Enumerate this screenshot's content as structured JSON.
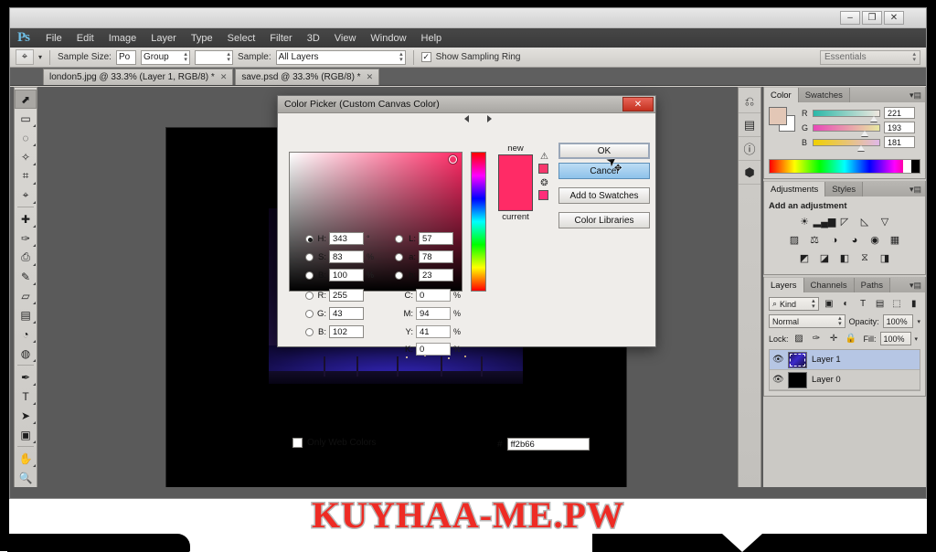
{
  "window": {
    "minimize": "–",
    "maximize": "❐",
    "close": "✕"
  },
  "menubar": {
    "logo": "Ps",
    "items": [
      "File",
      "Edit",
      "Image",
      "Layer",
      "Type",
      "Select",
      "Filter",
      "3D",
      "View",
      "Window",
      "Help"
    ]
  },
  "options_bar": {
    "tool_icon": "eyedropper-icon",
    "sample_size_label": "Sample Size:",
    "sample_size_value": "Po",
    "group_value": "Group",
    "blank_value": "",
    "sample_label": "Sample:",
    "sample_value": "All Layers",
    "show_sampling_ring_label": "Show Sampling Ring",
    "show_sampling_ring_checked": "✓",
    "workspace": "Essentials"
  },
  "tabs": [
    {
      "label": "london5.jpg @ 33.3% (Layer 1, RGB/8) *",
      "close": "✕"
    },
    {
      "label": "save.psd @ 33.3% (RGB/8) *",
      "close": "✕"
    }
  ],
  "toolbar": {
    "tools": [
      {
        "name": "move-tool",
        "glyph": "⬈",
        "selected": true
      },
      {
        "name": "marquee-tool",
        "glyph": "▭"
      },
      {
        "name": "lasso-tool",
        "glyph": "◌"
      },
      {
        "name": "quick-selection-tool",
        "glyph": "✧"
      },
      {
        "name": "crop-tool",
        "glyph": "⌗"
      },
      {
        "name": "eyedropper-tool",
        "glyph": "⌖"
      },
      {
        "name": "spot-healing-tool",
        "glyph": "✚"
      },
      {
        "name": "brush-tool",
        "glyph": "✑"
      },
      {
        "name": "clone-stamp-tool",
        "glyph": "⎙"
      },
      {
        "name": "history-brush-tool",
        "glyph": "✎"
      },
      {
        "name": "eraser-tool",
        "glyph": "▱"
      },
      {
        "name": "gradient-tool",
        "glyph": "▤"
      },
      {
        "name": "blur-tool",
        "glyph": "◔"
      },
      {
        "name": "dodge-tool",
        "glyph": "◍"
      },
      {
        "name": "pen-tool",
        "glyph": "✒"
      },
      {
        "name": "type-tool",
        "glyph": "T"
      },
      {
        "name": "path-selection-tool",
        "glyph": "➤"
      },
      {
        "name": "rectangle-tool",
        "glyph": "▣"
      },
      {
        "name": "hand-tool",
        "glyph": "✋"
      },
      {
        "name": "zoom-tool",
        "glyph": "🔍"
      }
    ],
    "foreground_color": "#e3c7b6",
    "background_color": "#ffffff"
  },
  "dock_rail": {
    "icons": [
      {
        "name": "history-icon",
        "glyph": "⎌"
      },
      {
        "name": "properties-icon",
        "glyph": "▤"
      },
      {
        "name": "info-icon",
        "glyph": "ⓘ"
      },
      {
        "name": "3d-icon",
        "glyph": "⬢"
      }
    ]
  },
  "color_panel": {
    "tabs": [
      "Color",
      "Swatches"
    ],
    "active_tab": "Color",
    "menu_glyph": "▾▤",
    "foreground_color": "#e3c7b6",
    "background_color": "#ffffff",
    "channels": [
      {
        "label": "R",
        "value": "221"
      },
      {
        "label": "G",
        "value": "193"
      },
      {
        "label": "B",
        "value": "181"
      }
    ]
  },
  "adjustments_panel": {
    "tabs": [
      "Adjustments",
      "Styles"
    ],
    "active_tab": "Adjustments",
    "menu_glyph": "▾▤",
    "title": "Add an adjustment",
    "rows": [
      [
        {
          "name": "brightness-contrast-icon",
          "glyph": "☀"
        },
        {
          "name": "levels-icon",
          "glyph": "▂▄▆"
        },
        {
          "name": "curves-icon",
          "glyph": "◸"
        },
        {
          "name": "exposure-icon",
          "glyph": "◺"
        },
        {
          "name": "vibrance-icon",
          "glyph": "▽"
        }
      ],
      [
        {
          "name": "hue-saturation-icon",
          "glyph": "▨"
        },
        {
          "name": "color-balance-icon",
          "glyph": "⚖"
        },
        {
          "name": "black-white-icon",
          "glyph": "◑"
        },
        {
          "name": "photo-filter-icon",
          "glyph": "◕"
        },
        {
          "name": "channel-mixer-icon",
          "glyph": "◉"
        },
        {
          "name": "color-lookup-icon",
          "glyph": "▦"
        }
      ],
      [
        {
          "name": "invert-icon",
          "glyph": "◩"
        },
        {
          "name": "posterize-icon",
          "glyph": "◪"
        },
        {
          "name": "threshold-icon",
          "glyph": "◧"
        },
        {
          "name": "gradient-map-icon",
          "glyph": "⧖"
        },
        {
          "name": "selective-color-icon",
          "glyph": "◨"
        }
      ]
    ]
  },
  "layers_panel": {
    "tabs": [
      "Layers",
      "Channels",
      "Paths"
    ],
    "active_tab": "Layers",
    "menu_glyph": "▾▤",
    "filter_label": "Kind",
    "filter_icon": "search-icon",
    "filter_type_icons": [
      {
        "name": "filter-pixel-icon",
        "glyph": "▣"
      },
      {
        "name": "filter-adjustment-icon",
        "glyph": "◐"
      },
      {
        "name": "filter-type-icon",
        "glyph": "T"
      },
      {
        "name": "filter-shape-icon",
        "glyph": "▤"
      },
      {
        "name": "filter-smart-icon",
        "glyph": "⬚"
      }
    ],
    "filter_toggle_glyph": "▮",
    "blend_mode": "Normal",
    "opacity_label": "Opacity:",
    "opacity_value": "100%",
    "lock_label": "Lock:",
    "lock_icons": [
      {
        "name": "lock-transparent-icon",
        "glyph": "▨"
      },
      {
        "name": "lock-image-icon",
        "glyph": "✑"
      },
      {
        "name": "lock-position-icon",
        "glyph": "✛"
      },
      {
        "name": "lock-all-icon",
        "glyph": "🔒"
      }
    ],
    "fill_label": "Fill:",
    "fill_value": "100%",
    "layers": [
      {
        "name": "Layer 1",
        "visible": "👁",
        "selected": true,
        "thumb": "#2a1d6e"
      },
      {
        "name": "Layer 0",
        "visible": "👁",
        "selected": false,
        "thumb": "#000000"
      }
    ]
  },
  "color_picker": {
    "title": "Color Picker (Custom Canvas Color)",
    "close_glyph": "✕",
    "new_label": "new",
    "current_label": "current",
    "new_color": "#ff2b66",
    "current_color": "#ff2b66",
    "gamut_warning_glyph": "⚠",
    "gamut_warning_color": "#f7376c",
    "web_warning_glyph": "❂",
    "web_warning_color": "#ff2e7a",
    "buttons": {
      "ok": "OK",
      "cancel": "Cancel",
      "add_to_swatches": "Add to Swatches",
      "color_libraries": "Color Libraries"
    },
    "hsb": [
      {
        "label": "H:",
        "value": "343",
        "unit": "°",
        "selected": true
      },
      {
        "label": "S:",
        "value": "83",
        "unit": "%",
        "selected": false
      },
      {
        "label": "B:",
        "value": "100",
        "unit": "%",
        "selected": false
      }
    ],
    "rgb": [
      {
        "label": "R:",
        "value": "255",
        "unit": "",
        "selected": false
      },
      {
        "label": "G:",
        "value": "43",
        "unit": "",
        "selected": false
      },
      {
        "label": "B:",
        "value": "102",
        "unit": "",
        "selected": false
      }
    ],
    "lab": [
      {
        "label": "L:",
        "value": "57",
        "unit": "",
        "selected": false
      },
      {
        "label": "a:",
        "value": "78",
        "unit": "",
        "selected": false
      },
      {
        "label": "b:",
        "value": "23",
        "unit": "",
        "selected": false
      }
    ],
    "cmyk": [
      {
        "label": "C:",
        "value": "0",
        "unit": "%"
      },
      {
        "label": "M:",
        "value": "94",
        "unit": "%"
      },
      {
        "label": "Y:",
        "value": "41",
        "unit": "%"
      },
      {
        "label": "K:",
        "value": "0",
        "unit": "%"
      }
    ],
    "only_web_colors_label": "Only Web Colors",
    "only_web_colors_checked": "",
    "hex_symbol": "#",
    "hex_value": "ff2b66"
  },
  "cursor": {
    "arrow_glyph": "➤",
    "move_glyph": "✥"
  },
  "watermark": {
    "text": "KUYHAA-ME.PW",
    "color": "#ee2b24"
  }
}
